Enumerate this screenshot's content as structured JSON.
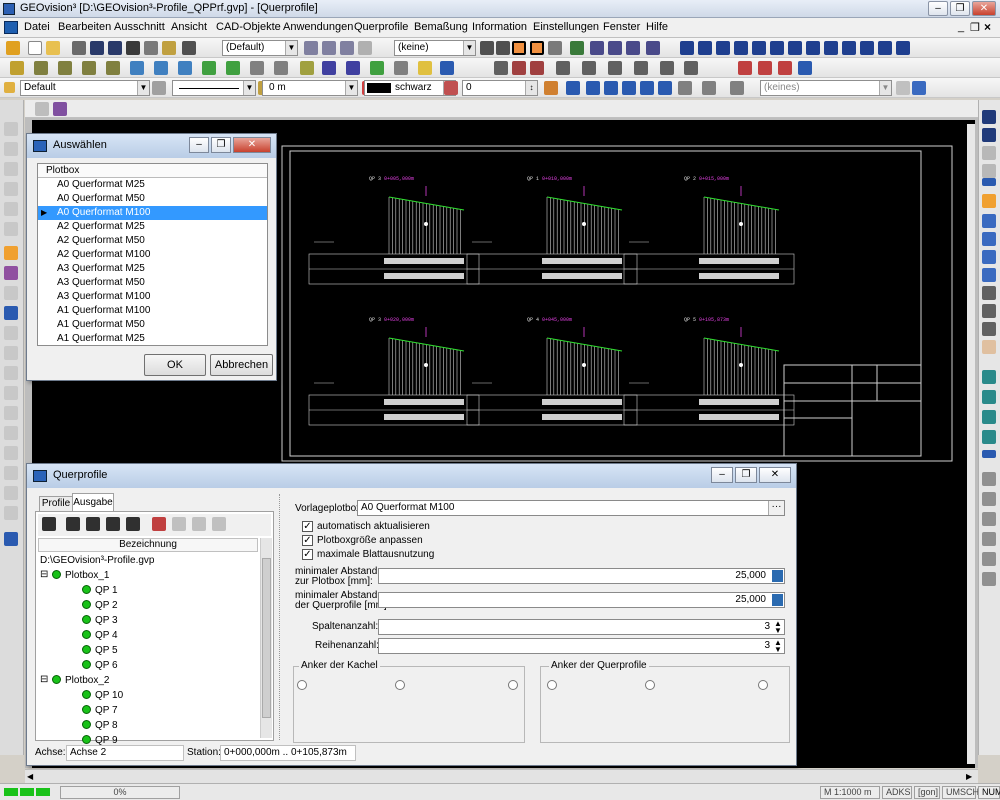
{
  "window": {
    "title": "GEOvision³  [D:\\GEOvision³-Profile_QPPrf.gvp] - [Querprofile]"
  },
  "menu": [
    "Datei",
    "Bearbeiten",
    "Ausschnitt",
    "Ansicht",
    "CAD-Objekte",
    "Anwendungen",
    "Querprofile",
    "Bemaßung",
    "Information",
    "Einstellungen",
    "Fenster",
    "Hilfe"
  ],
  "toolbar1": {
    "style_combo": "(Default)",
    "keine_combo": "(keine)"
  },
  "toolbar3": {
    "layer_combo": "Default",
    "width_combo": "0 m",
    "color_combo": "schwarz",
    "value_combo": "0",
    "keines_combo": "(keines)"
  },
  "auswaehlen": {
    "title": "Auswählen",
    "header": "Plotbox",
    "items": [
      "A0 Querformat M25",
      "A0 Querformat M50",
      "A0 Querformat M100",
      "A2 Querformat M25",
      "A2 Querformat M50",
      "A2 Querformat M100",
      "A3 Querformat M25",
      "A3 Querformat M50",
      "A3 Querformat M100",
      "A1 Querformat M100",
      "A1 Querformat M50",
      "A1 Querformat M25"
    ],
    "selected_index": 2,
    "ok": "OK",
    "cancel": "Abbrechen"
  },
  "querprofile": {
    "title": "Querprofile",
    "tabs": [
      "Profile",
      "Ausgabe"
    ],
    "tree_header": "Bezeichnung",
    "tree_root": "D:\\GEOvision³-Profile.gvp",
    "plotbox1": "Plotbox_1",
    "plotbox1_items": [
      "QP 1",
      "QP 2",
      "QP 3",
      "QP 4",
      "QP 5",
      "QP 6"
    ],
    "plotbox2": "Plotbox_2",
    "plotbox2_items": [
      "QP 10",
      "QP 7",
      "QP 8",
      "QP 9"
    ],
    "vorlage_label": "Vorlageplotbox:",
    "vorlage_value": "A0 Querformat M100",
    "vorlage_btn": "···",
    "checks": [
      "automatisch aktualisieren",
      "Plotboxgröße anpassen",
      "maximale Blattausnutzung"
    ],
    "abstand_plotbox_label1": "minimaler Abstand",
    "abstand_plotbox_label2": "zur Plotbox [mm]:",
    "abstand_plotbox_value": "25,000",
    "abstand_qp_label1": "minimaler Abstand",
    "abstand_qp_label2": "der Querprofile [mm]:",
    "abstand_qp_value": "25,000",
    "spalten_label": "Spaltenanzahl:",
    "spalten_value": "3",
    "reihen_label": "Reihenanzahl:",
    "reihen_value": "3",
    "anker_kachel": "Anker der Kachel",
    "anker_qp": "Anker der Querprofile",
    "achse_label": "Achse:",
    "achse_value": "Achse 2",
    "station_label": "Station:",
    "station_value": "0+000,000m .. 0+105,873m"
  },
  "cad": {
    "profiles": [
      {
        "label": "QP 3",
        "station": "0+005,000m"
      },
      {
        "label": "QP 1",
        "station": "0+010,000m"
      },
      {
        "label": "QP 2",
        "station": "0+015,000m"
      },
      {
        "label": "QP 3",
        "station": "0+020,000m"
      },
      {
        "label": "QP 4",
        "station": "0+045,000m"
      },
      {
        "label": "QP 5",
        "station": "0+105,873m"
      }
    ]
  },
  "status": {
    "progress": "0%",
    "scale": "M 1:1000  m",
    "adks": "ADKS",
    "gon": "[gon]",
    "umsch": "UMSCH",
    "num": "NUM"
  }
}
